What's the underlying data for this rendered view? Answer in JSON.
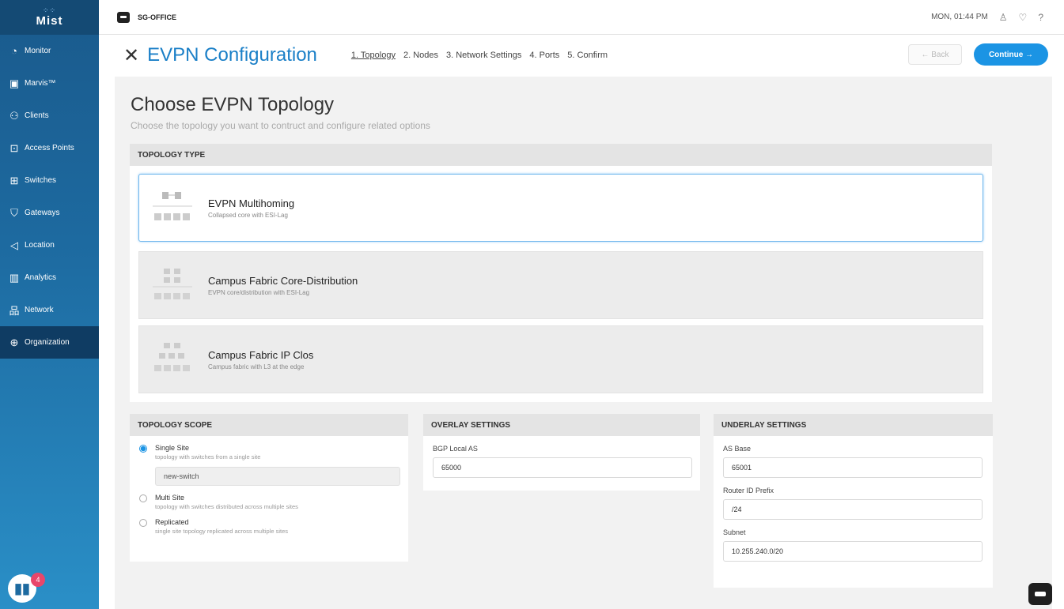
{
  "sidebar": {
    "logo": "Mist",
    "items": [
      {
        "label": "Monitor",
        "icon": "monitor-icon",
        "glyph": "◔"
      },
      {
        "label": "Marvis™",
        "icon": "marvis-icon",
        "glyph": "▣"
      },
      {
        "label": "Clients",
        "icon": "clients-icon",
        "glyph": "⚇"
      },
      {
        "label": "Access Points",
        "icon": "access-point-icon",
        "glyph": "⊡"
      },
      {
        "label": "Switches",
        "icon": "switch-icon",
        "glyph": "⊞"
      },
      {
        "label": "Gateways",
        "icon": "gateway-icon",
        "glyph": "⛉"
      },
      {
        "label": "Location",
        "icon": "location-icon",
        "glyph": "◁"
      },
      {
        "label": "Analytics",
        "icon": "analytics-icon",
        "glyph": "▥"
      },
      {
        "label": "Network",
        "icon": "network-icon",
        "glyph": "品"
      },
      {
        "label": "Organization",
        "icon": "organization-icon",
        "glyph": "⊕"
      }
    ],
    "help_badge": "4"
  },
  "topbar": {
    "site_name": "SG-OFFICE",
    "datetime": "MON, 01:44 PM"
  },
  "header": {
    "title": "EVPN Configuration",
    "steps": [
      "1. Topology",
      "2. Nodes",
      "3. Network Settings",
      "4. Ports",
      "5. Confirm"
    ],
    "back_label": "← Back",
    "continue_label": "Continue →"
  },
  "content": {
    "heading": "Choose EVPN Topology",
    "subtitle": "Choose the topology you want to contruct and configure related options",
    "topology_type": {
      "header": "TOPOLOGY TYPE",
      "options": [
        {
          "name": "EVPN Multihoming",
          "desc": "Collapsed core with ESI-Lag"
        },
        {
          "name": "Campus Fabric Core-Distribution",
          "desc": "EVPN core/distribution with ESI-Lag"
        },
        {
          "name": "Campus Fabric IP Clos",
          "desc": "Campus fabric with L3 at the edge"
        }
      ]
    },
    "topology_scope": {
      "header": "TOPOLOGY SCOPE",
      "options": [
        {
          "label": "Single Site",
          "desc": "topology with switches from a single site"
        },
        {
          "label": "Multi Site",
          "desc": "topology with switches distributed across multiple sites"
        },
        {
          "label": "Replicated",
          "desc": "single site topology replicated across multiple sites"
        }
      ],
      "site_value": "new-switch"
    },
    "overlay": {
      "header": "OVERLAY SETTINGS",
      "bgp_label": "BGP Local AS",
      "bgp_value": "65000"
    },
    "underlay": {
      "header": "UNDERLAY SETTINGS",
      "as_base_label": "AS Base",
      "as_base_value": "65001",
      "router_id_label": "Router ID Prefix",
      "router_id_value": "/24",
      "subnet_label": "Subnet",
      "subnet_value": "10.255.240.0/20"
    }
  }
}
